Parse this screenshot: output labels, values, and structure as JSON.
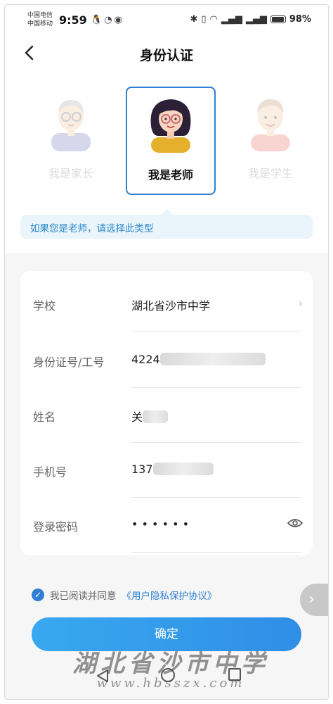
{
  "status_bar": {
    "carrier_1": "中国电信",
    "carrier_2": "中国移动",
    "time": "9:59",
    "battery": "98%"
  },
  "header": {
    "title": "身份认证"
  },
  "roles": {
    "items": [
      {
        "label": "我是家长",
        "selected": false
      },
      {
        "label": "我是老师",
        "selected": true
      },
      {
        "label": "我是学生",
        "selected": false
      }
    ],
    "hint": "如果您是老师，请选择此类型"
  },
  "form": {
    "school_label": "学校",
    "school_value": "湖北省沙市中学",
    "id_label": "身份证号/工号",
    "id_value": "4224",
    "name_label": "姓名",
    "name_value": "关",
    "phone_label": "手机号",
    "phone_value": "137",
    "password_label": "登录密码",
    "password_value": "• • • • • •"
  },
  "agreement": {
    "text": "我已阅读并同意",
    "link": "《用户隐私保护协议》",
    "checked": true
  },
  "confirm_label": "确定",
  "watermark": {
    "line1": "湖北省沙市中学",
    "line2": "www.hbsszx.com"
  },
  "colors": {
    "accent": "#2f7fd3",
    "hint_bg": "#e9f4fb",
    "button": "#38a8f0"
  }
}
